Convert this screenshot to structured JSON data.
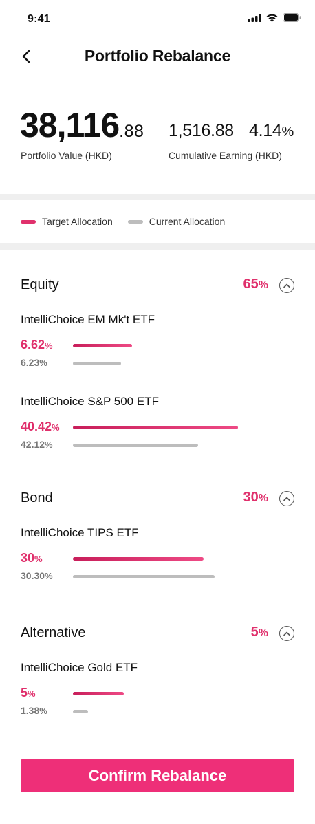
{
  "status_bar": {
    "time": "9:41"
  },
  "header": {
    "title": "Portfolio Rebalance"
  },
  "summary": {
    "value_main": "38,116",
    "value_decimal": ".88",
    "value_label": "Portfolio Value (HKD)",
    "earning": "1,516.88",
    "earning_pct": "4.14",
    "pct_sign": "%",
    "earning_label": "Cumulative Earning (HKD)"
  },
  "legend": {
    "target": "Target Allocation",
    "current": "Current Allocation"
  },
  "colors": {
    "accent": "#e0306c",
    "button": "#ee2f78",
    "current_bar": "#bdbdbd"
  },
  "groups": [
    {
      "name": "Equity",
      "pct": "65",
      "pct_sign": "%",
      "funds": [
        {
          "name": "IntelliChoice EM Mk't ETF",
          "target": "6.62",
          "current": "6.23",
          "target_level": 0.36,
          "current_level": 0.29
        },
        {
          "name": "IntelliChoice S&P 500 ETF",
          "target": "40.42",
          "current": "42.12",
          "target_level": 1.0,
          "current_level": 0.76
        }
      ]
    },
    {
      "name": "Bond",
      "pct": "30",
      "pct_sign": "%",
      "funds": [
        {
          "name": "IntelliChoice TIPS ETF",
          "target": "30",
          "current": "30.30",
          "target_level": 0.79,
          "current_level": 0.86
        }
      ]
    },
    {
      "name": "Alternative",
      "pct": "5",
      "pct_sign": "%",
      "funds": [
        {
          "name": "IntelliChoice Gold ETF",
          "target": "5",
          "current": "1.38",
          "target_level": 0.31,
          "current_level": 0.09
        }
      ]
    }
  ],
  "confirm_button": {
    "label": "Confirm Rebalance"
  }
}
